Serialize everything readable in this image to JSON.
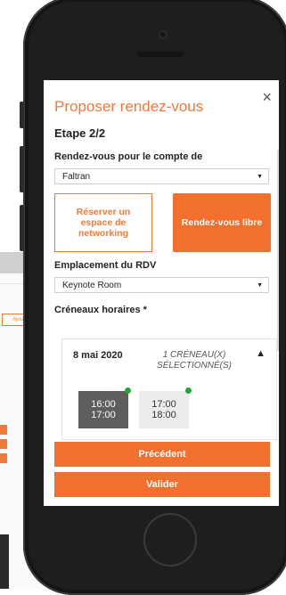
{
  "background": {
    "chip_label": "Ajout"
  },
  "modal": {
    "title": "Proposer rendez-vous",
    "close_label": "×",
    "step": "Etape 2/2",
    "account_label": "Rendez-vous pour le compte de",
    "account_value": "Faltran",
    "choices": [
      {
        "label": "Réserver un espace de networking",
        "selected": false
      },
      {
        "label": "Rendez-vous libre",
        "selected": true
      }
    ],
    "location_label": "Emplacement du RDV",
    "location_value": "Keynote Room",
    "slots_label": "Créneaux horaires *",
    "slot_day": {
      "date": "8 mai 2020",
      "summary": "1 CRÉNEAU(X) SÉLECTIONNÉ(S)",
      "collapse_icon": "chevron-up-icon",
      "slots": [
        {
          "start": "16:00",
          "end": "17:00",
          "selected": true
        },
        {
          "start": "17:00",
          "end": "18:00",
          "selected": false
        }
      ]
    },
    "prev_label": "Précédent",
    "submit_label": "Valider"
  },
  "colors": {
    "accent": "#f36f2d",
    "available_dot": "#1fa83a",
    "selected_slot": "#5e5e5e"
  }
}
